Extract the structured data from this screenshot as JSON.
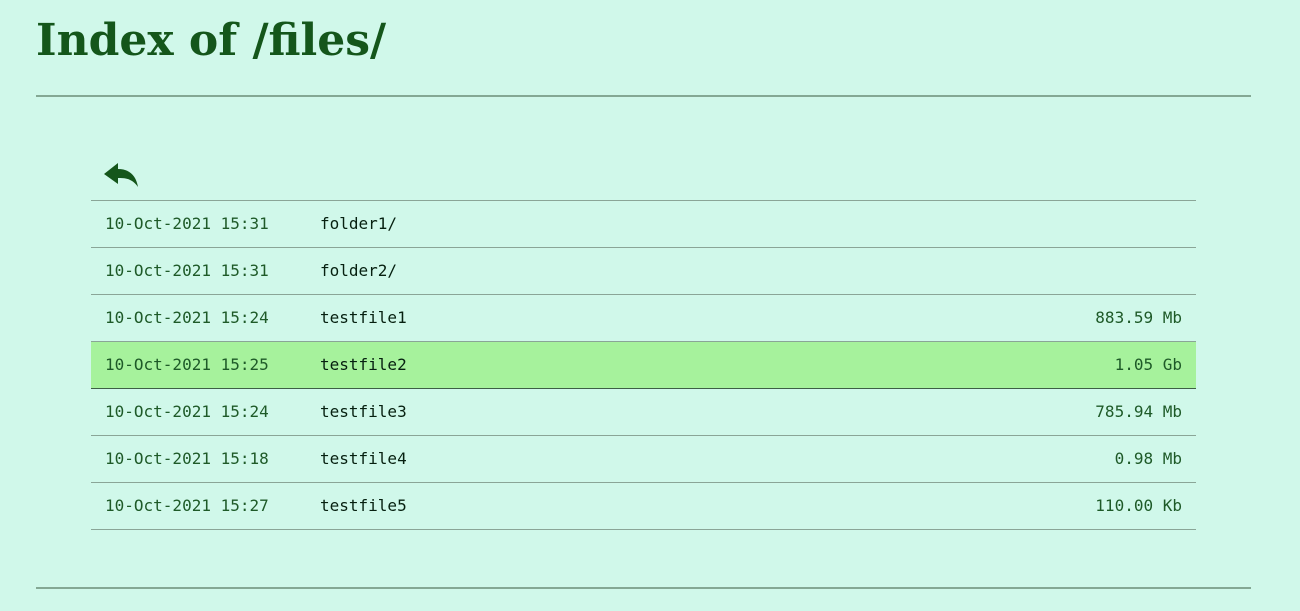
{
  "page": {
    "title": "Index of /files/"
  },
  "colors": {
    "background": "#d0f8ea",
    "title": "#14561b",
    "selected_row": "#a6f29c",
    "divider": "#84a894"
  },
  "back_link": {
    "icon": "reply-arrow-icon"
  },
  "files": [
    {
      "date": "10-Oct-2021 15:31",
      "name": "folder1/",
      "size": ""
    },
    {
      "date": "10-Oct-2021 15:31",
      "name": "folder2/",
      "size": ""
    },
    {
      "date": "10-Oct-2021 15:24",
      "name": "testfile1",
      "size": "883.59 Mb"
    },
    {
      "date": "10-Oct-2021 15:25",
      "name": "testfile2",
      "size": "1.05 Gb"
    },
    {
      "date": "10-Oct-2021 15:24",
      "name": "testfile3",
      "size": "785.94 Mb"
    },
    {
      "date": "10-Oct-2021 15:18",
      "name": "testfile4",
      "size": "0.98 Mb"
    },
    {
      "date": "10-Oct-2021 15:27",
      "name": "testfile5",
      "size": "110.00 Kb"
    }
  ],
  "selected_index": 3
}
